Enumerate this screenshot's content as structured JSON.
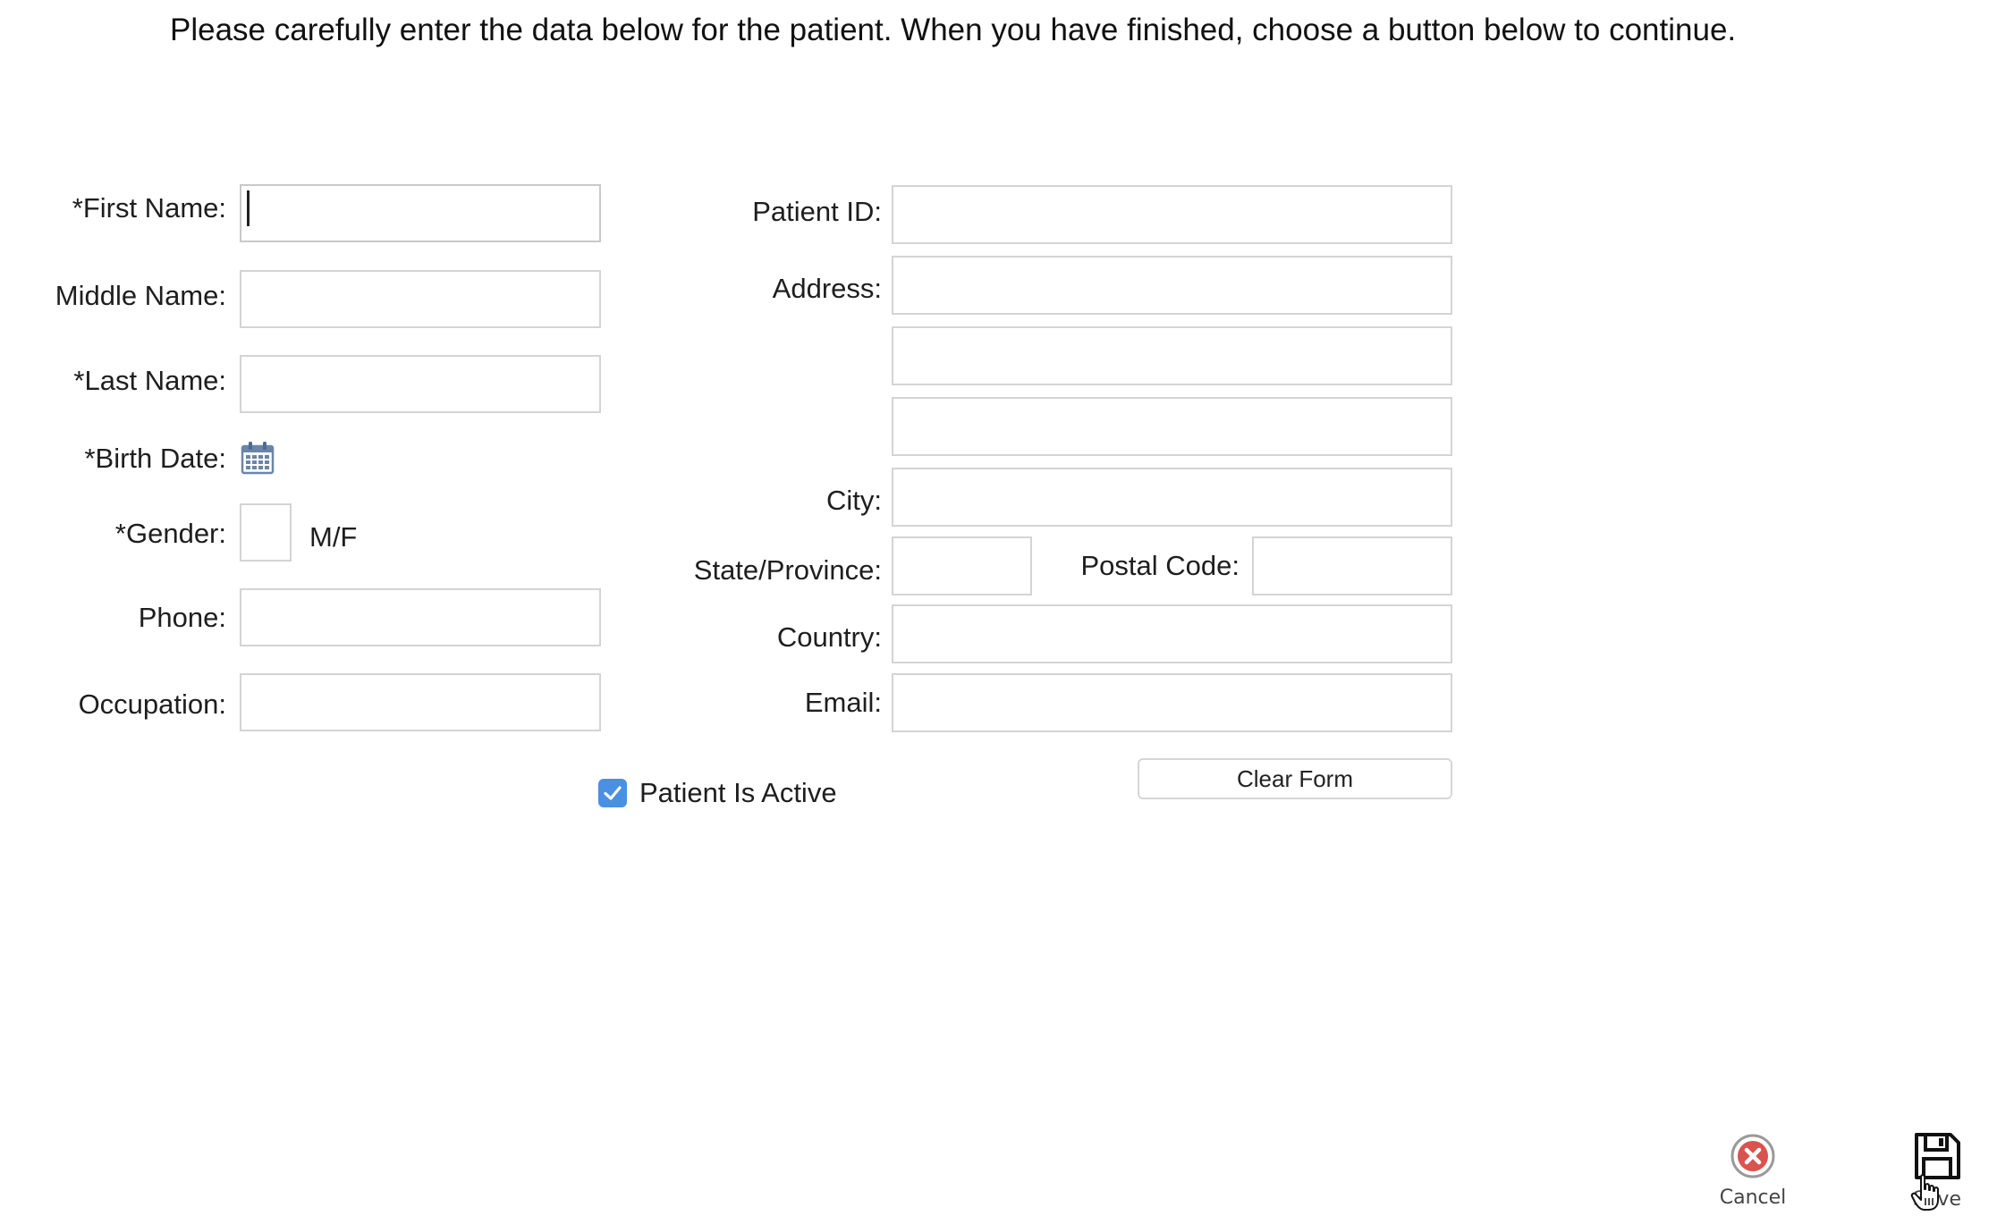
{
  "instructions": "Please carefully enter the data below for the patient.  When you have finished, choose a button below to continue.",
  "left_fields": {
    "first_name": {
      "label": "*First Name:",
      "value": ""
    },
    "middle_name": {
      "label": "Middle Name:",
      "value": ""
    },
    "last_name": {
      "label": "*Last Name:",
      "value": ""
    },
    "birth_date": {
      "label": "*Birth Date:",
      "icon": "calendar-icon"
    },
    "gender": {
      "label": "*Gender:",
      "value": "",
      "hint": "M/F"
    },
    "phone": {
      "label": "Phone:",
      "value": ""
    },
    "occupation": {
      "label": "Occupation:",
      "value": ""
    }
  },
  "right_fields": {
    "patient_id": {
      "label": "Patient ID:",
      "value": ""
    },
    "address": {
      "label": "Address:",
      "line1": "",
      "line2": "",
      "line3": ""
    },
    "city": {
      "label": "City:",
      "value": ""
    },
    "state": {
      "label": "State/Province:",
      "value": ""
    },
    "postal_code": {
      "label": "Postal Code:",
      "value": ""
    },
    "country": {
      "label": "Country:",
      "value": ""
    },
    "email": {
      "label": "Email:",
      "value": ""
    }
  },
  "patient_active": {
    "label": "Patient Is Active",
    "checked": true
  },
  "clear_button": "Clear Form",
  "actions": {
    "cancel": {
      "label": "Cancel",
      "icon": "cancel-icon"
    },
    "save": {
      "label": "Save",
      "icon": "save-icon"
    }
  },
  "colors": {
    "checkbox": "#4a90e2",
    "cancel_icon": "#d9534f",
    "input_border": "#d4d4d4"
  }
}
